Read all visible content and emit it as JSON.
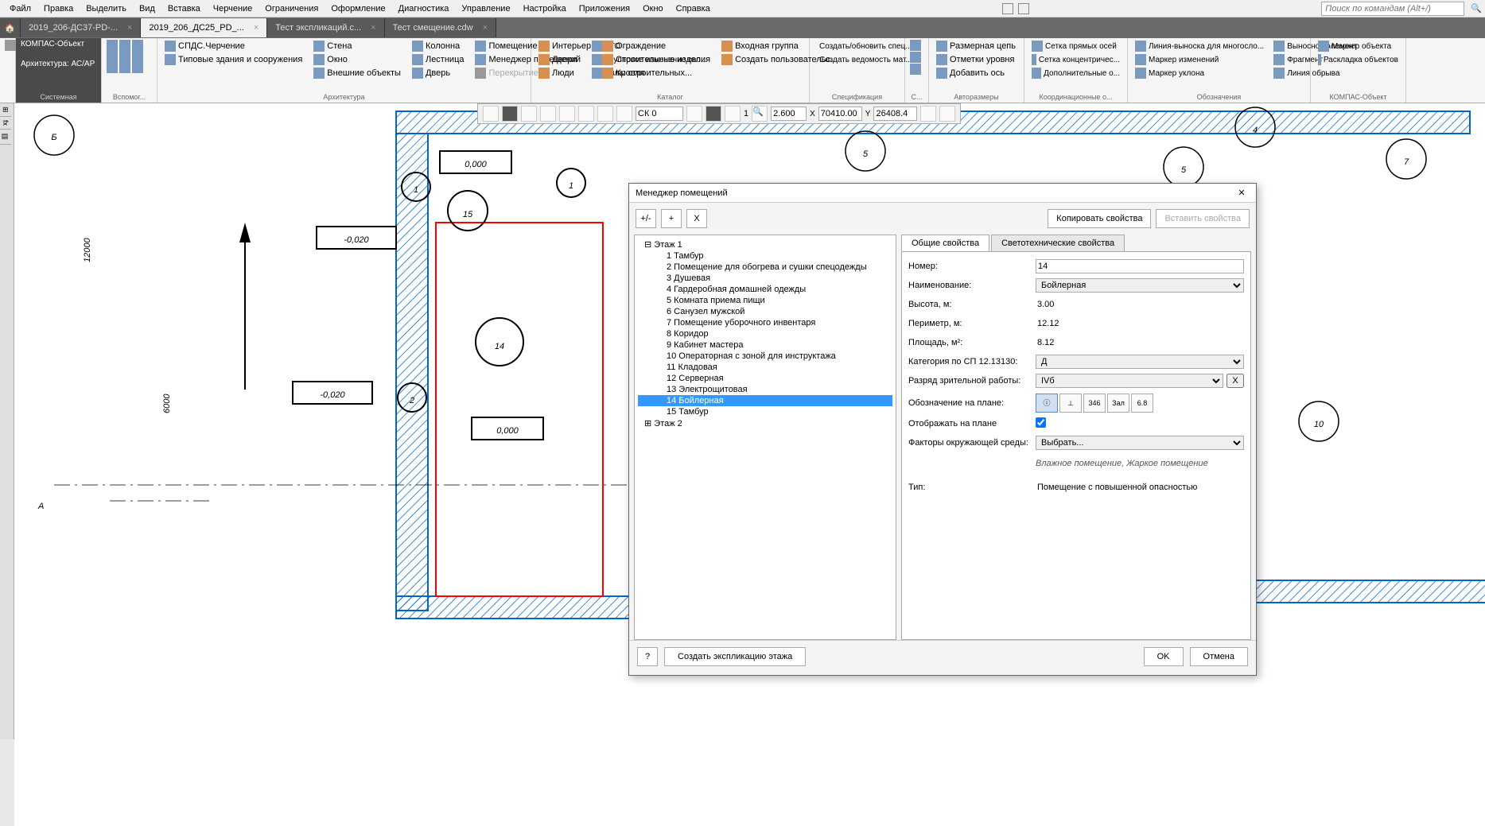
{
  "menubar": {
    "items": [
      "Файл",
      "Правка",
      "Выделить",
      "Вид",
      "Вставка",
      "Черчение",
      "Ограничения",
      "Оформление",
      "Диагностика",
      "Управление",
      "Настройка",
      "Приложения",
      "Окно",
      "Справка"
    ],
    "search_placeholder": "Поиск по командам (Alt+/)"
  },
  "tabs": [
    {
      "label": "2019_206-ДС37-PD-...",
      "active": false
    },
    {
      "label": "2019_206_ДС25_PD_...",
      "active": true
    },
    {
      "label": "Тест экспликаций.с...",
      "active": false
    },
    {
      "label": "Тест смещение.cdw",
      "active": false
    }
  ],
  "arch_panel": {
    "title": "КОМПАС-Объект",
    "subtitle": "Архитектура: АС/АР"
  },
  "ribbon": {
    "groups": [
      {
        "label": "Системная"
      },
      {
        "label": "Вспомог..."
      },
      {
        "label": "Архитектура",
        "items": [
          "СПДС.Черчение",
          "Стена",
          "Колонна",
          "Помещение",
          "Типовые здания и сооружения",
          "УГО",
          "Окно",
          "Лестница",
          "Менеджер помещений",
          "Внешние объекты",
          "Дверь",
          "Перекрытие",
          "Групповое изменение сво...",
          "Узлы строительных..."
        ]
      },
      {
        "label": "Каталог",
        "items": [
          "Интерьер",
          "Двери",
          "Люди",
          "Ограждение",
          "Строительные изделия",
          "Кровля",
          "Входная группа",
          "Создать пользовательс..."
        ]
      },
      {
        "label": "Спецификация",
        "items": [
          "Создать/обновить спец...",
          "Создать ведомость мат..."
        ]
      },
      {
        "label": "С..."
      },
      {
        "label": "Авторазмеры",
        "items": [
          "Размерная цепь",
          "Отметки уровня",
          "Добавить ось"
        ]
      },
      {
        "label": "Координационные о...",
        "items": [
          "Сетка прямых осей",
          "Сетка концентричес...",
          "Дополнительные о..."
        ]
      },
      {
        "label": "Обозначения",
        "items": [
          "Линия-выноска для многосло...",
          "Маркер изменений",
          "Маркер уклона",
          "Выносной элемент",
          "Фрагмент",
          "Линия обрыва"
        ]
      },
      {
        "label": "КОМПАС-Объект",
        "items": [
          "Маркер объекта",
          "Раскладка объектов"
        ]
      }
    ]
  },
  "toolbar2": {
    "sk": "СК 0",
    "zoom": "2.600",
    "x_label": "X",
    "x_val": "70410.00",
    "y_label": "Y",
    "y_val": "26408.4"
  },
  "canvas": {
    "marks": [
      "4",
      "5",
      "5",
      "7",
      "10"
    ],
    "dims": [
      "12000",
      "6000",
      "0,000",
      "-0,020",
      "-0,020",
      "0,000"
    ],
    "circles": [
      "1",
      "1",
      "15",
      "2",
      "14"
    ],
    "axis_a": "А"
  },
  "dialog": {
    "title": "Менеджер помещений",
    "btns": {
      "toggle": "+/-",
      "add": "+",
      "del": "X"
    },
    "copy_props": "Копировать свойства",
    "paste_props": "Вставить свойства",
    "tree": {
      "floor1": "Этаж 1",
      "rooms": [
        "1 Тамбур",
        "2 Помещение для обогрева и сушки спецодежды",
        "3 Душевая",
        "4 Гардеробная домашней одежды",
        "5 Комната приема пищи",
        "6 Санузел мужской",
        "7 Помещение уборочного инвентаря",
        "8 Коридор",
        "9 Кабинет мастера",
        "10 Операторная с зоной для инструктажа",
        "11 Кладовая",
        "12 Серверная",
        "13 Электрощитовая",
        "14 Бойлерная",
        "15 Тамбур"
      ],
      "floor2": "Этаж 2",
      "selected_index": 13
    },
    "tabs": {
      "general": "Общие свойства",
      "lighting": "Светотехнические свойства"
    },
    "props": {
      "number_label": "Номер:",
      "number": "14",
      "name_label": "Наименование:",
      "name": "Бойлерная",
      "height_label": "Высота, м:",
      "height": "3.00",
      "perimeter_label": "Периметр, м:",
      "perimeter": "12.12",
      "area_label": "Площадь, м²:",
      "area": "8.12",
      "category_label": "Категория по СП 12.13130:",
      "category": "Д",
      "razryad_label": "Разряд зрительной работы:",
      "razryad": "IVб",
      "razryad_x": "X",
      "plan_mark_label": "Обозначение на плане:",
      "show_plan_label": "Отображать на плане",
      "factors_label": "Факторы окружающей среды:",
      "factors": "Выбрать...",
      "factors_hint": "Влажное помещение, Жаркое помещение",
      "type_label": "Тип:",
      "type": "Помещение с повышенной опасностью",
      "icon_btns": [
        "i",
        "⊥",
        "346",
        "Зал",
        "6.8"
      ]
    },
    "footer": {
      "help": "?",
      "export": "Создать экспликацию этажа",
      "ok": "OK",
      "cancel": "Отмена"
    }
  }
}
